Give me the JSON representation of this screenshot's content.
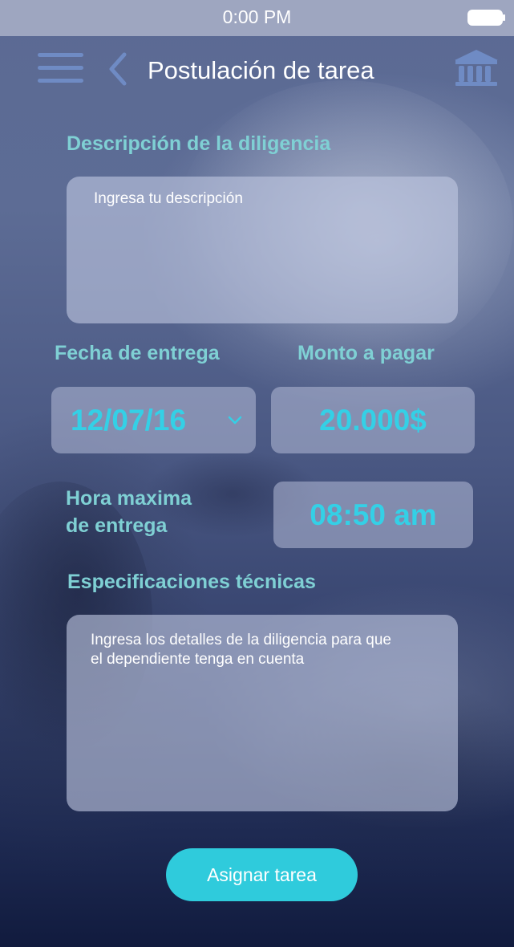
{
  "status_bar": {
    "time": "0:00 PM"
  },
  "header": {
    "title": "Postulación de tarea",
    "menu_icon": "hamburger-menu-icon",
    "back_icon": "chevron-left-icon",
    "institution_icon": "bank-building-icon"
  },
  "form": {
    "description": {
      "label": "Descripción de la diligencia",
      "placeholder": "Ingresa tu descripción"
    },
    "delivery_date": {
      "label": "Fecha de entrega",
      "value": "12/07/16"
    },
    "amount": {
      "label": "Monto a pagar",
      "value": "20.000$"
    },
    "max_time": {
      "label_line1": "Hora maxima",
      "label_line2": "de entrega",
      "value": "08:50 am"
    },
    "specs": {
      "label": "Especificaciones técnicas",
      "placeholder_line1": "Ingresa los detalles de la diligencia para que",
      "placeholder_line2": "el dependiente tenga en cuenta"
    }
  },
  "actions": {
    "assign_label": "Asignar tarea"
  },
  "colors": {
    "accent": "#2fcbdc",
    "label": "#7fd0d4",
    "value": "#34d0e6",
    "icon": "#6f8bc4"
  }
}
